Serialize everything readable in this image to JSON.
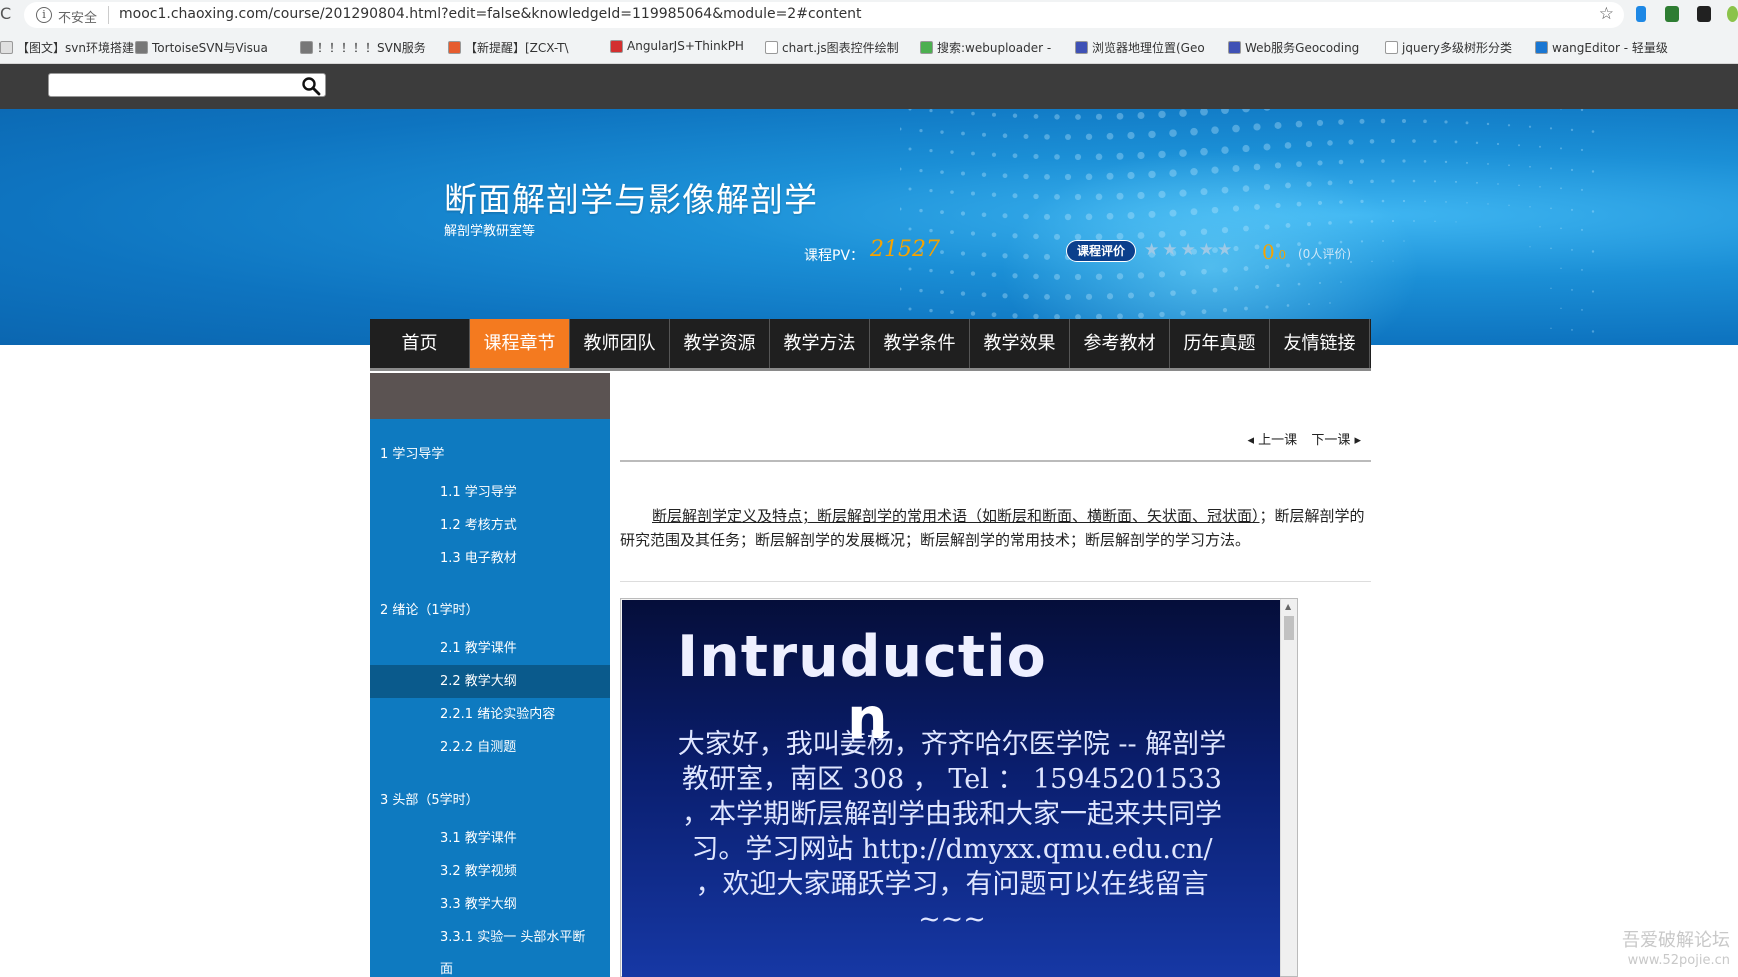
{
  "browser": {
    "security_label": "不安全",
    "url": "mooc1.chaoxing.com/course/201290804.html?edit=false&knowledgeId=119985064&module=2#content",
    "bookmarks": [
      {
        "label": "【图文】svn环境搭建",
        "color": "#e0e0e0"
      },
      {
        "label": "TortoiseSVN与Visua",
        "color": "#777"
      },
      {
        "label": "！！！！！SVN服务",
        "color": "#777"
      },
      {
        "label": "【新提醒】[ZCX-T\\",
        "color": "#e65c2e"
      },
      {
        "label": "AngularJS+ThinkPH",
        "color": "#d32f2f"
      },
      {
        "label": "chart.js图表控件绘制",
        "color": "#ffffff"
      },
      {
        "label": "搜索:webuploader -",
        "color": "#4caf50"
      },
      {
        "label": "浏览器地理位置(Geo",
        "color": "#3f51b5"
      },
      {
        "label": "Web服务Geocoding",
        "color": "#3f51b5"
      },
      {
        "label": "jquery多级树形分类",
        "color": "#ffffff"
      },
      {
        "label": "wangEditor - 轻量级",
        "color": "#1976d2"
      }
    ]
  },
  "site": {
    "search_placeholder": "",
    "course_title": "断面解剖学与影像解剖学",
    "course_subtitle": "解剖学教研室等",
    "pv_label": "课程PV：",
    "pv_value": "21527",
    "rate_button": "课程评价",
    "stars": "★★★★★",
    "score": "0.0",
    "raters": "(0人评价)"
  },
  "nav": [
    {
      "label": "首页",
      "active": false
    },
    {
      "label": "课程章节",
      "active": true
    },
    {
      "label": "教师团队",
      "active": false
    },
    {
      "label": "教学资源",
      "active": false
    },
    {
      "label": "教学方法",
      "active": false
    },
    {
      "label": "教学条件",
      "active": false
    },
    {
      "label": "教学效果",
      "active": false
    },
    {
      "label": "参考教材",
      "active": false
    },
    {
      "label": "历年真题",
      "active": false
    },
    {
      "label": "友情链接",
      "active": false
    }
  ],
  "sidebar": {
    "chapters": [
      {
        "label": "1 学习导学"
      },
      {
        "label": "2 绪论（1学时）"
      },
      {
        "label": "3 头部（5学时）"
      }
    ],
    "sections": [
      "1.1 学习导学",
      "1.2 考核方式",
      "1.3 电子教材",
      "2.1 教学课件",
      "2.2 教学大纲",
      "2.2.1  绪论实验内容",
      "2.2.2  自测题",
      "3.1 教学课件",
      "3.2 教学视频",
      "3.3 教学大纲",
      "3.3.1  实验一 头部水平断",
      "面"
    ],
    "current_section": "2.2 教学大纲"
  },
  "content": {
    "prev_label": "上一课",
    "next_label": "下一课",
    "intro_underlined": "断层解剖学定义及特点；断层解剖学的常用术语（如断层和断面、横断面、矢状面、冠状面）",
    "intro_rest": "；断层解剖学的研究范围及其任务；断层解剖学的发展概况；断层解剖学的常用技术；断层解剖学的学习方法。",
    "slide_title_line1": "Intruductio",
    "slide_title_line2": "n",
    "slide_body": "大家好，我叫姜杨，齐齐哈尔医学院 -- 解剖学教研室，南区 308 ， Tel ： 15945201533 ，本学期断层解剖学由我和大家一起来共同学习。学习网站 http://dmyxx.qmu.edu.cn/ ，欢迎大家踊跃学习，有问题可以在线留言 ~~~"
  },
  "watermark": {
    "line1": "吾爱破解论坛",
    "line2": "www.52pojie.cn"
  }
}
